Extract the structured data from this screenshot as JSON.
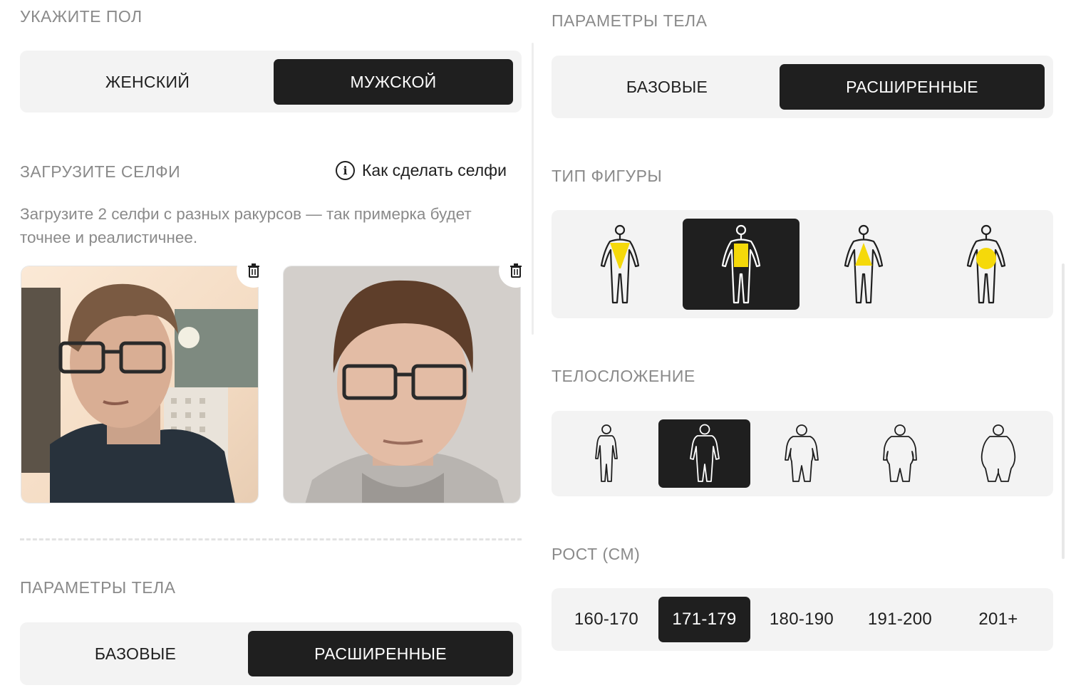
{
  "left": {
    "gender": {
      "label": "УКАЖИТЕ ПОЛ",
      "options": [
        {
          "label": "ЖЕНСКИЙ",
          "active": false
        },
        {
          "label": "МУЖСКОЙ",
          "active": true
        }
      ]
    },
    "selfie": {
      "label": "ЗАГРУЗИТЕ СЕЛФИ",
      "howto_link": "Как сделать селфи",
      "hint": "Загрузите 2 селфи с разных ракурсов — так примерка будет точнее и реалистичнее."
    },
    "body_params": {
      "label": "ПАРАМЕТРЫ ТЕЛА",
      "options": [
        {
          "label": "БАЗОВЫЕ",
          "active": false
        },
        {
          "label": "РАСШИРЕННЫЕ",
          "active": true
        }
      ]
    }
  },
  "right": {
    "body_params": {
      "label": "ПАРАМЕТРЫ ТЕЛА",
      "options": [
        {
          "label": "БАЗОВЫЕ",
          "active": false
        },
        {
          "label": "РАСШИРЕННЫЕ",
          "active": true
        }
      ]
    },
    "figure_type": {
      "label": "ТИП ФИГУРЫ",
      "options": [
        {
          "icon": "inverted-triangle-figure-icon",
          "active": false
        },
        {
          "icon": "rectangle-figure-icon",
          "active": true
        },
        {
          "icon": "triangle-figure-icon",
          "active": false
        },
        {
          "icon": "oval-figure-icon",
          "active": false
        }
      ],
      "highlight_color": "#f5d90a"
    },
    "build": {
      "label": "ТЕЛОСЛОЖЕНИЕ",
      "options": [
        {
          "icon": "slim-body-icon",
          "active": false
        },
        {
          "icon": "average-body-icon",
          "active": true
        },
        {
          "icon": "stocky-body-icon",
          "active": false
        },
        {
          "icon": "full-body-icon",
          "active": false
        },
        {
          "icon": "obese-body-icon",
          "active": false
        }
      ]
    },
    "height": {
      "label": "РОСТ (СМ)",
      "options": [
        {
          "label": "160-170",
          "active": false
        },
        {
          "label": "171-179",
          "active": true
        },
        {
          "label": "180-190",
          "active": false
        },
        {
          "label": "191-200",
          "active": false
        },
        {
          "label": "201+",
          "active": false
        }
      ]
    }
  },
  "colors": {
    "accent_dark": "#1f1f1f",
    "segment_bg": "#f3f3f3",
    "label_gray": "#8a8a8a",
    "highlight": "#f5d90a"
  }
}
